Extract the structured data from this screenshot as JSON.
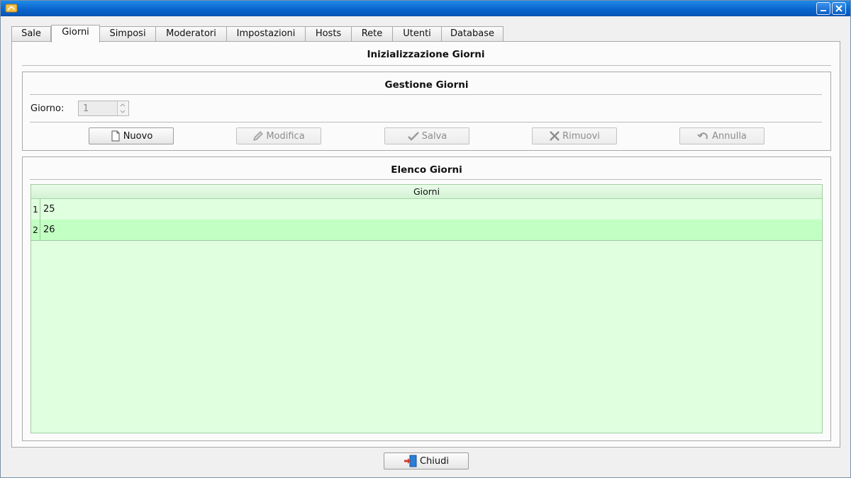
{
  "tabs": [
    "Sale",
    "Giorni",
    "Simposi",
    "Moderatori",
    "Impostazioni",
    "Hosts",
    "Rete",
    "Utenti",
    "Database"
  ],
  "panel": {
    "title": "Inizializzazione Giorni",
    "gestione": {
      "title": "Gestione Giorni",
      "giorno_label": "Giorno:",
      "giorno_value": "1",
      "buttons": {
        "nuovo": "Nuovo",
        "modifica": "Modifica",
        "salva": "Salva",
        "rimuovi": "Rimuovi",
        "annulla": "Annulla"
      }
    },
    "elenco": {
      "title": "Elenco Giorni",
      "column_header": "Giorni",
      "rows": [
        {
          "index": "1",
          "value": "25"
        },
        {
          "index": "2",
          "value": "26"
        }
      ]
    }
  },
  "footer": {
    "chiudi": "Chiudi"
  },
  "colors": {
    "titlebar": "#0a66cf",
    "table_bg": "#dfffdf",
    "selected_row": "#c2ffc2"
  }
}
